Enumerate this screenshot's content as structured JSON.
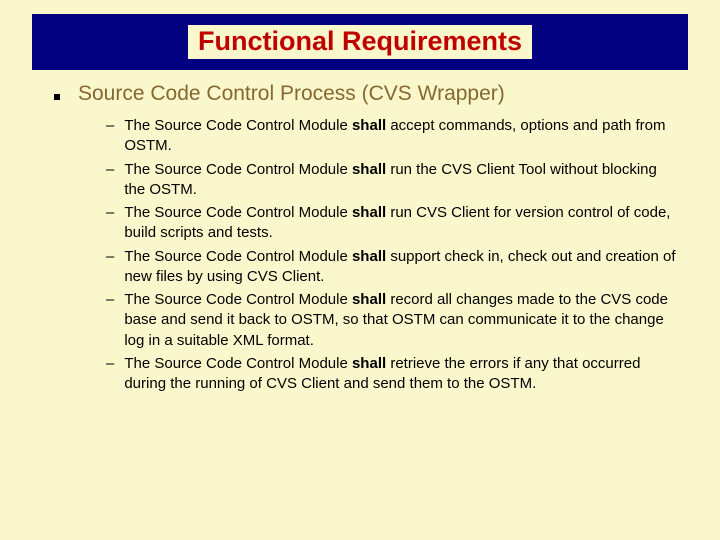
{
  "title": "Functional Requirements",
  "main": {
    "heading": "Source Code Control Process (CVS Wrapper)",
    "items": [
      {
        "prefix": "The Source Code Control Module ",
        "bold": "shall",
        "suffix": " accept commands, options and path from OSTM."
      },
      {
        "prefix": "The Source Code Control Module ",
        "bold": "shall",
        "suffix": " run the CVS Client Tool without blocking the OSTM."
      },
      {
        "prefix": "The Source Code Control Module ",
        "bold": "shall",
        "suffix": " run CVS Client for version control of code, build scripts and tests."
      },
      {
        "prefix": "The Source Code Control Module ",
        "bold": "shall",
        "suffix": " support check in, check out and creation of new files by using CVS Client."
      },
      {
        "prefix": "The Source Code Control Module ",
        "bold": "shall",
        "suffix": " record all changes made to the CVS code base and send it back to OSTM, so that OSTM can communicate it to the change log in a suitable XML format."
      },
      {
        "prefix": "The Source Code Control Module ",
        "bold": "shall",
        "suffix": " retrieve the errors if any that occurred during the running of CVS Client and send them to the OSTM."
      }
    ]
  }
}
